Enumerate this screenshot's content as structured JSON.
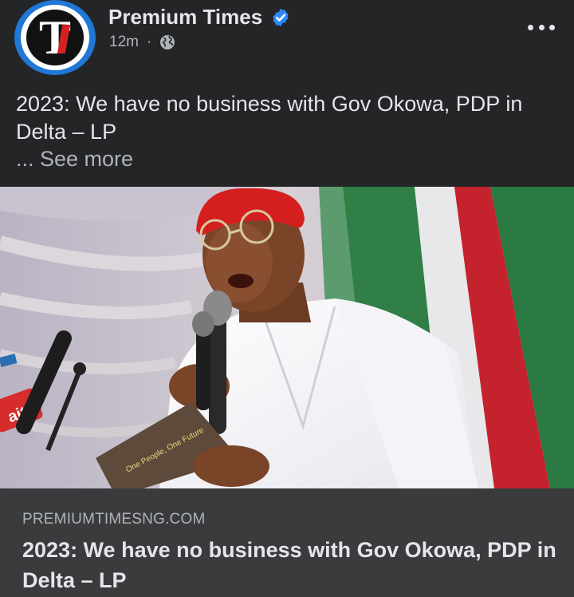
{
  "post": {
    "page_name": "Premium Times",
    "time_ago": "12m",
    "separator": "·",
    "caption": "2023: We have no business with Gov Okowa, PDP in Delta – LP",
    "see_more": "... See more",
    "avatar_letter": "T",
    "icons": {
      "verified": "verified-badge-icon",
      "audience": "globe-icon",
      "options": "more-options-icon"
    }
  },
  "link_preview": {
    "domain": "PREMIUMTIMESNG.COM",
    "title": "2023: We have no business with Gov Okowa, PDP in Delta – LP"
  },
  "photo": {
    "mic_flag_text": "ait",
    "book_text": "One People, One Future"
  },
  "colors": {
    "background": "#242526",
    "link_card": "#3a3b3c",
    "primary_text": "#e4e6eb",
    "secondary_text": "#b0b3b8",
    "verified_blue": "#2d88ff",
    "avatar_ring": "#1f77d6"
  }
}
